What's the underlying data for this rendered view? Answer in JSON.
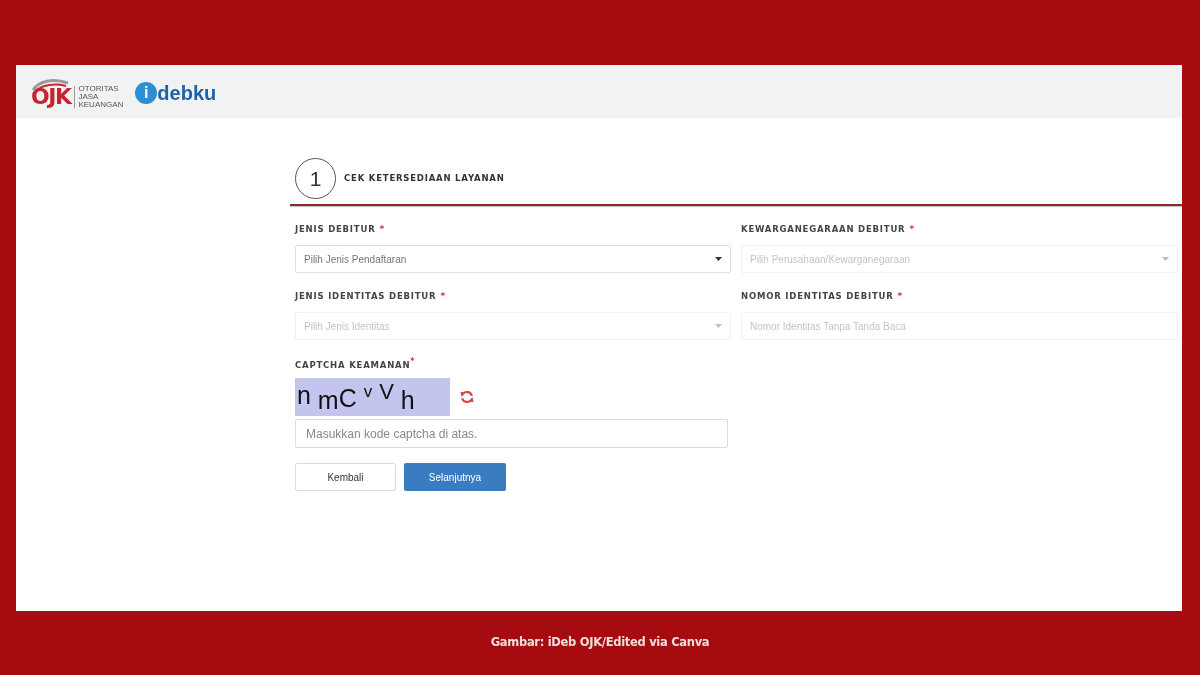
{
  "header": {
    "org_logo": {
      "text": "OJK",
      "name_lines": [
        "OTORITAS",
        "JASA",
        "KEUANGAN"
      ]
    },
    "app_logo": {
      "mark": "i",
      "text": "debku"
    }
  },
  "step": {
    "number": "1",
    "title": "CEK KETERSEDIAAN LAYANAN"
  },
  "fields": [
    {
      "label": "JENIS DEBITUR",
      "required_mark": "*",
      "kind": "select",
      "placeholder": "Pilih Jenis Pendaftaran",
      "disabled": false
    },
    {
      "label": "KEWARGANEGARAAN DEBITUR",
      "required_mark": "*",
      "kind": "select",
      "placeholder": "Pilih Perusahaan/Kewarganegaraan",
      "disabled": true
    },
    {
      "label": "JENIS IDENTITAS DEBITUR",
      "required_mark": "*",
      "kind": "select",
      "placeholder": "Pilih Jenis Identitas",
      "disabled": true
    },
    {
      "label": "NOMOR IDENTITAS DEBITUR",
      "required_mark": "*",
      "kind": "text",
      "placeholder": "Nomor Identitas Tanpa Tanda Baca",
      "disabled": true
    }
  ],
  "captcha": {
    "label": "CAPTCHA KEAMANAN",
    "required_mark": "*",
    "code": "n mC v V h",
    "placeholder": "Masukkan kode captcha di atas."
  },
  "buttons": [
    {
      "label": "Kembali",
      "kind": "secondary"
    },
    {
      "label": "Selanjutnya",
      "kind": "primary"
    }
  ],
  "caption": "Gambar: iDeb OJK/Edited via Canva"
}
